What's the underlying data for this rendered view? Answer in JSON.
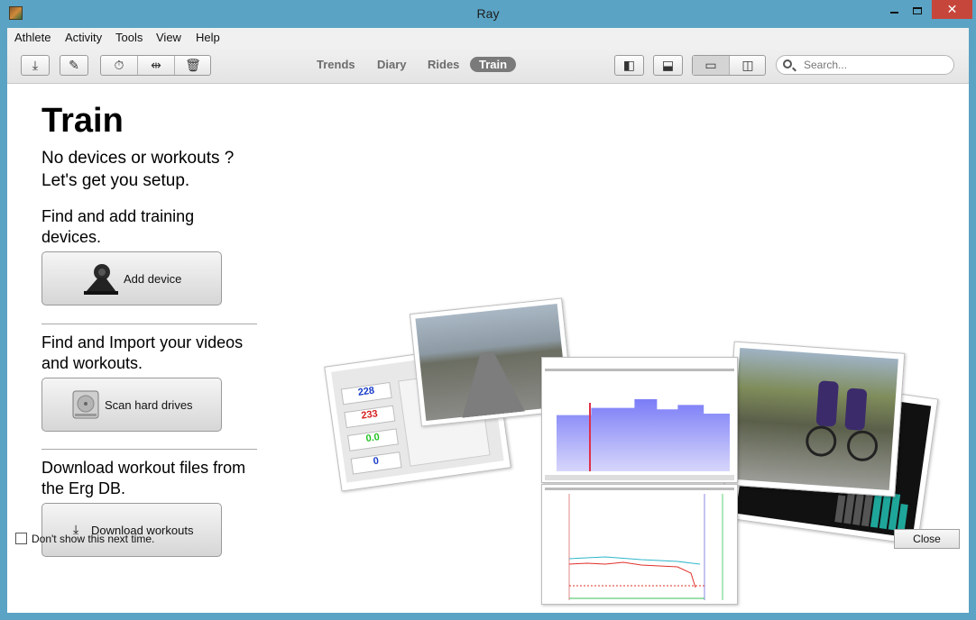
{
  "window": {
    "title": "Ray"
  },
  "controls": {
    "minimize": "minimize",
    "maximize": "maximize",
    "close": "✕"
  },
  "menu": [
    "Athlete",
    "Activity",
    "Tools",
    "View",
    "Help"
  ],
  "nav": {
    "tabs": [
      "Trends",
      "Diary",
      "Rides",
      "Train"
    ],
    "active": "Train"
  },
  "search": {
    "placeholder": "Search..."
  },
  "page": {
    "title": "Train",
    "intro_1": "No devices or workouts ?",
    "intro_2": "Let's get you setup.",
    "devices_text": "Find and add training devices.",
    "add_device": "Add device",
    "videos_text": "Find and Import your videos and workouts.",
    "scan": "Scan hard drives",
    "erg_text": "Download workout files from the Erg DB.",
    "download": "Download workouts"
  },
  "footer": {
    "dont_show": "Don't show this next time.",
    "close": "Close"
  },
  "collage": {
    "values": [
      "228",
      "233",
      "0.0",
      "0"
    ]
  },
  "colors": {
    "titlebar": "#5aa3c4",
    "close": "#c7463b",
    "active_tab": "#7a7a7a"
  }
}
